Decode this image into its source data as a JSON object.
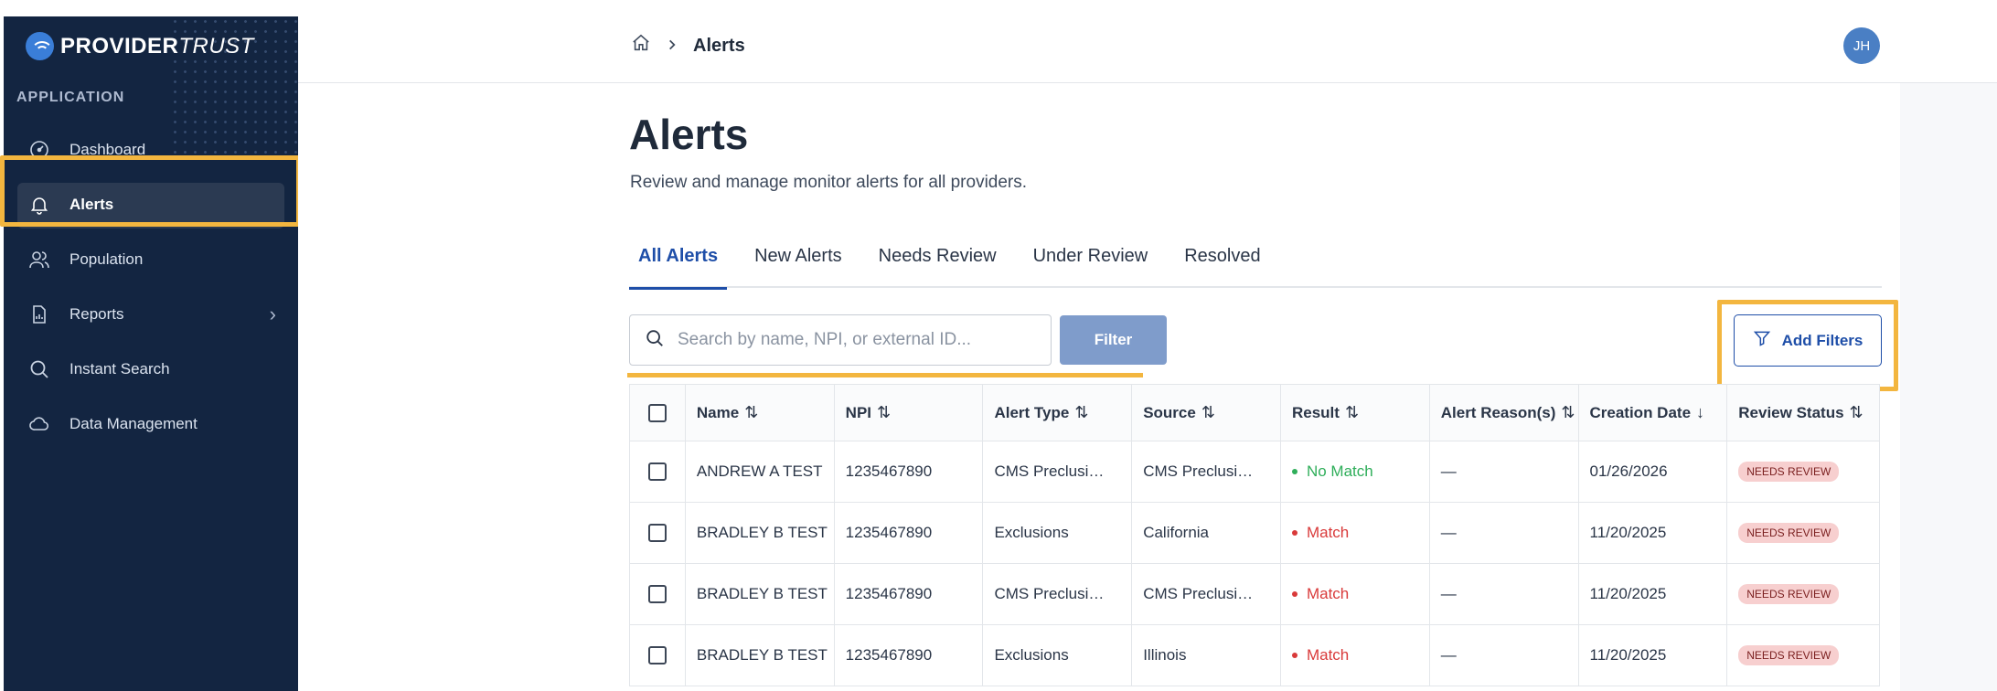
{
  "brand": {
    "name_bold": "PROVIDER",
    "name_italic": "TRUST"
  },
  "sidebar": {
    "section_label": "APPLICATION",
    "items": [
      {
        "label": "Dashboard",
        "icon": "gauge-icon"
      },
      {
        "label": "Alerts",
        "icon": "bell-icon",
        "active": true
      },
      {
        "label": "Population",
        "icon": "people-icon"
      },
      {
        "label": "Reports",
        "icon": "report-icon",
        "has_children": true
      },
      {
        "label": "Instant Search",
        "icon": "search-icon"
      },
      {
        "label": "Data Management",
        "icon": "cloud-icon"
      }
    ]
  },
  "header": {
    "breadcrumb_current": "Alerts",
    "avatar_initials": "JH"
  },
  "page": {
    "title": "Alerts",
    "subtitle": "Review and manage monitor alerts for all providers."
  },
  "tabs": [
    "All Alerts",
    "New Alerts",
    "Needs Review",
    "Under Review",
    "Resolved"
  ],
  "search": {
    "placeholder": "Search by name, NPI, or external ID..."
  },
  "toolbar": {
    "filter_label": "Filter",
    "add_filters_label": "Add Filters"
  },
  "table": {
    "columns": [
      "Name",
      "NPI",
      "Alert Type",
      "Source",
      "Result",
      "Alert Reason(s)",
      "Creation Date",
      "Review Status"
    ],
    "rows": [
      {
        "name": "ANDREW A TEST",
        "npi": "1235467890",
        "alert_type": "CMS Preclusio…",
        "source": "CMS Preclusio…",
        "result": "No Match",
        "reason": "—",
        "date": "01/26/2026",
        "status": "NEEDS REVIEW"
      },
      {
        "name": "BRADLEY B  TEST",
        "npi": "1235467890",
        "alert_type": "Exclusions",
        "source": "California",
        "result": "Match",
        "reason": "—",
        "date": "11/20/2025",
        "status": "NEEDS REVIEW"
      },
      {
        "name": "BRADLEY B  TEST",
        "npi": "1235467890",
        "alert_type": "CMS Preclusio…",
        "source": "CMS Preclusio…",
        "result": "Match",
        "reason": "—",
        "date": "11/20/2025",
        "status": "NEEDS REVIEW"
      },
      {
        "name": "BRADLEY B  TEST",
        "npi": "1235467890",
        "alert_type": "Exclusions",
        "source": "Illinois",
        "result": "Match",
        "reason": "—",
        "date": "11/20/2025",
        "status": "NEEDS REVIEW"
      }
    ]
  },
  "colors": {
    "sidebar_bg": "#132541",
    "accent": "#1e4ea8",
    "highlight": "#f3b63f",
    "match": "#d93a3a",
    "no_match": "#2fae5a",
    "badge_bg": "#f7cfcf"
  }
}
